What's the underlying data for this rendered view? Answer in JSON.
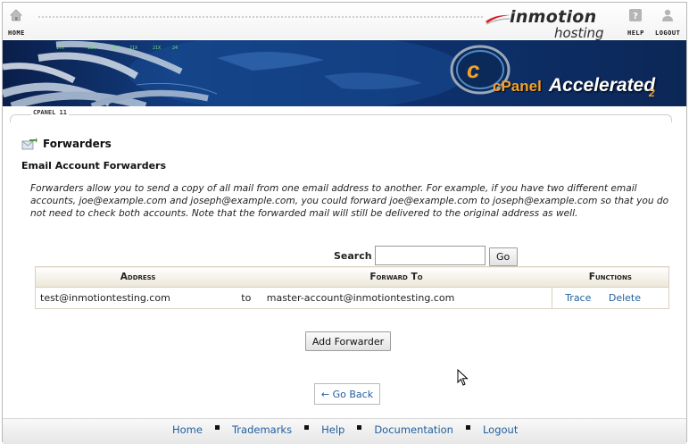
{
  "header": {
    "home_label": "HOME",
    "help_label": "HELP",
    "logout_label": "LOGOUT",
    "brand_name": "inmotion",
    "brand_sub": "hosting",
    "banner_cpanel": "cPanel",
    "banner_accelerated": "Accelerated",
    "banner_version": "2",
    "cpanel_version": "CPANEL 11"
  },
  "page": {
    "title": "Forwarders",
    "section_title": "Email Account Forwarders",
    "description": "Forwarders allow you to send a copy of all mail from one email address to another. For example, if you have two different email accounts, joe@example.com and joseph@example.com, you could forward joe@example.com to joseph@example.com so that you do not need to check both accounts. Note that the forwarded mail will still be delivered to the original address as well."
  },
  "search": {
    "label": "Search",
    "value": "",
    "button": "Go"
  },
  "table": {
    "headers": [
      "Address",
      "Forward To",
      "Functions"
    ],
    "rows": [
      {
        "address": "test@inmotiontesting.com",
        "to": "to",
        "forward_to": "master-account@inmotiontesting.com",
        "trace": "Trace",
        "delete": "Delete"
      }
    ]
  },
  "actions": {
    "add_forwarder": "Add Forwarder",
    "go_back": "← Go Back"
  },
  "footer": {
    "links": [
      "Home",
      "Trademarks",
      "Help",
      "Documentation",
      "Logout"
    ]
  },
  "colors": {
    "link": "#1f5f9e",
    "banner_dark": "#0a1e4a",
    "cpanel_orange": "#f4a12a",
    "brand_red": "#d8202b"
  }
}
